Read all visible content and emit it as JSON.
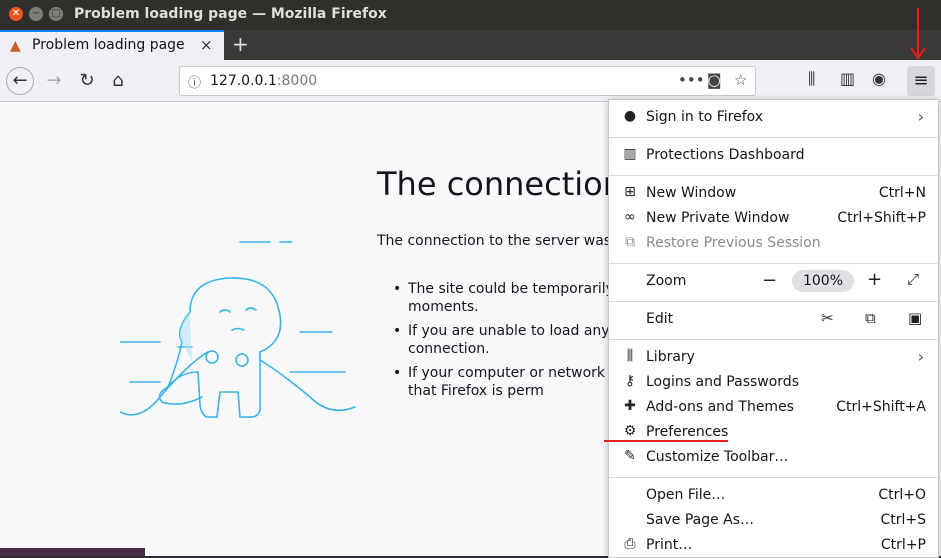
{
  "window": {
    "title": "Problem loading page — Mozilla Firefox"
  },
  "tab": {
    "label": "Problem loading page",
    "close": "×",
    "new_tab": "+"
  },
  "urlbar": {
    "host": "127.0.0.1",
    "port": ":8000"
  },
  "error_page": {
    "title": "The connection",
    "description": "The connection to the server was r",
    "bullets": [
      "The site could be temporarily a few moments.",
      "If you are unable to load any p network connection.",
      "If your computer or network is make sure that Firefox is perm"
    ]
  },
  "menu": {
    "sign_in": "Sign in to Firefox",
    "protections": "Protections Dashboard",
    "new_window": {
      "label": "New Window",
      "shortcut": "Ctrl+N"
    },
    "new_private": {
      "label": "New Private Window",
      "shortcut": "Ctrl+Shift+P"
    },
    "restore": {
      "label": "Restore Previous Session"
    },
    "zoom": {
      "label": "Zoom",
      "minus": "−",
      "value": "100%",
      "plus": "+"
    },
    "edit": {
      "label": "Edit"
    },
    "library": "Library",
    "logins": "Logins and Passwords",
    "addons": {
      "label": "Add-ons and Themes",
      "shortcut": "Ctrl+Shift+A"
    },
    "preferences": "Preferences",
    "customize": "Customize Toolbar…",
    "open_file": {
      "label": "Open File…",
      "shortcut": "Ctrl+O"
    },
    "save_page": {
      "label": "Save Page As…",
      "shortcut": "Ctrl+S"
    },
    "print": {
      "label": "Print…",
      "shortcut": "Ctrl+P"
    }
  },
  "colors": {
    "accent": "#0a84ff",
    "annotation_red": "#e0201a",
    "ubuntu_orange": "#e95420"
  }
}
